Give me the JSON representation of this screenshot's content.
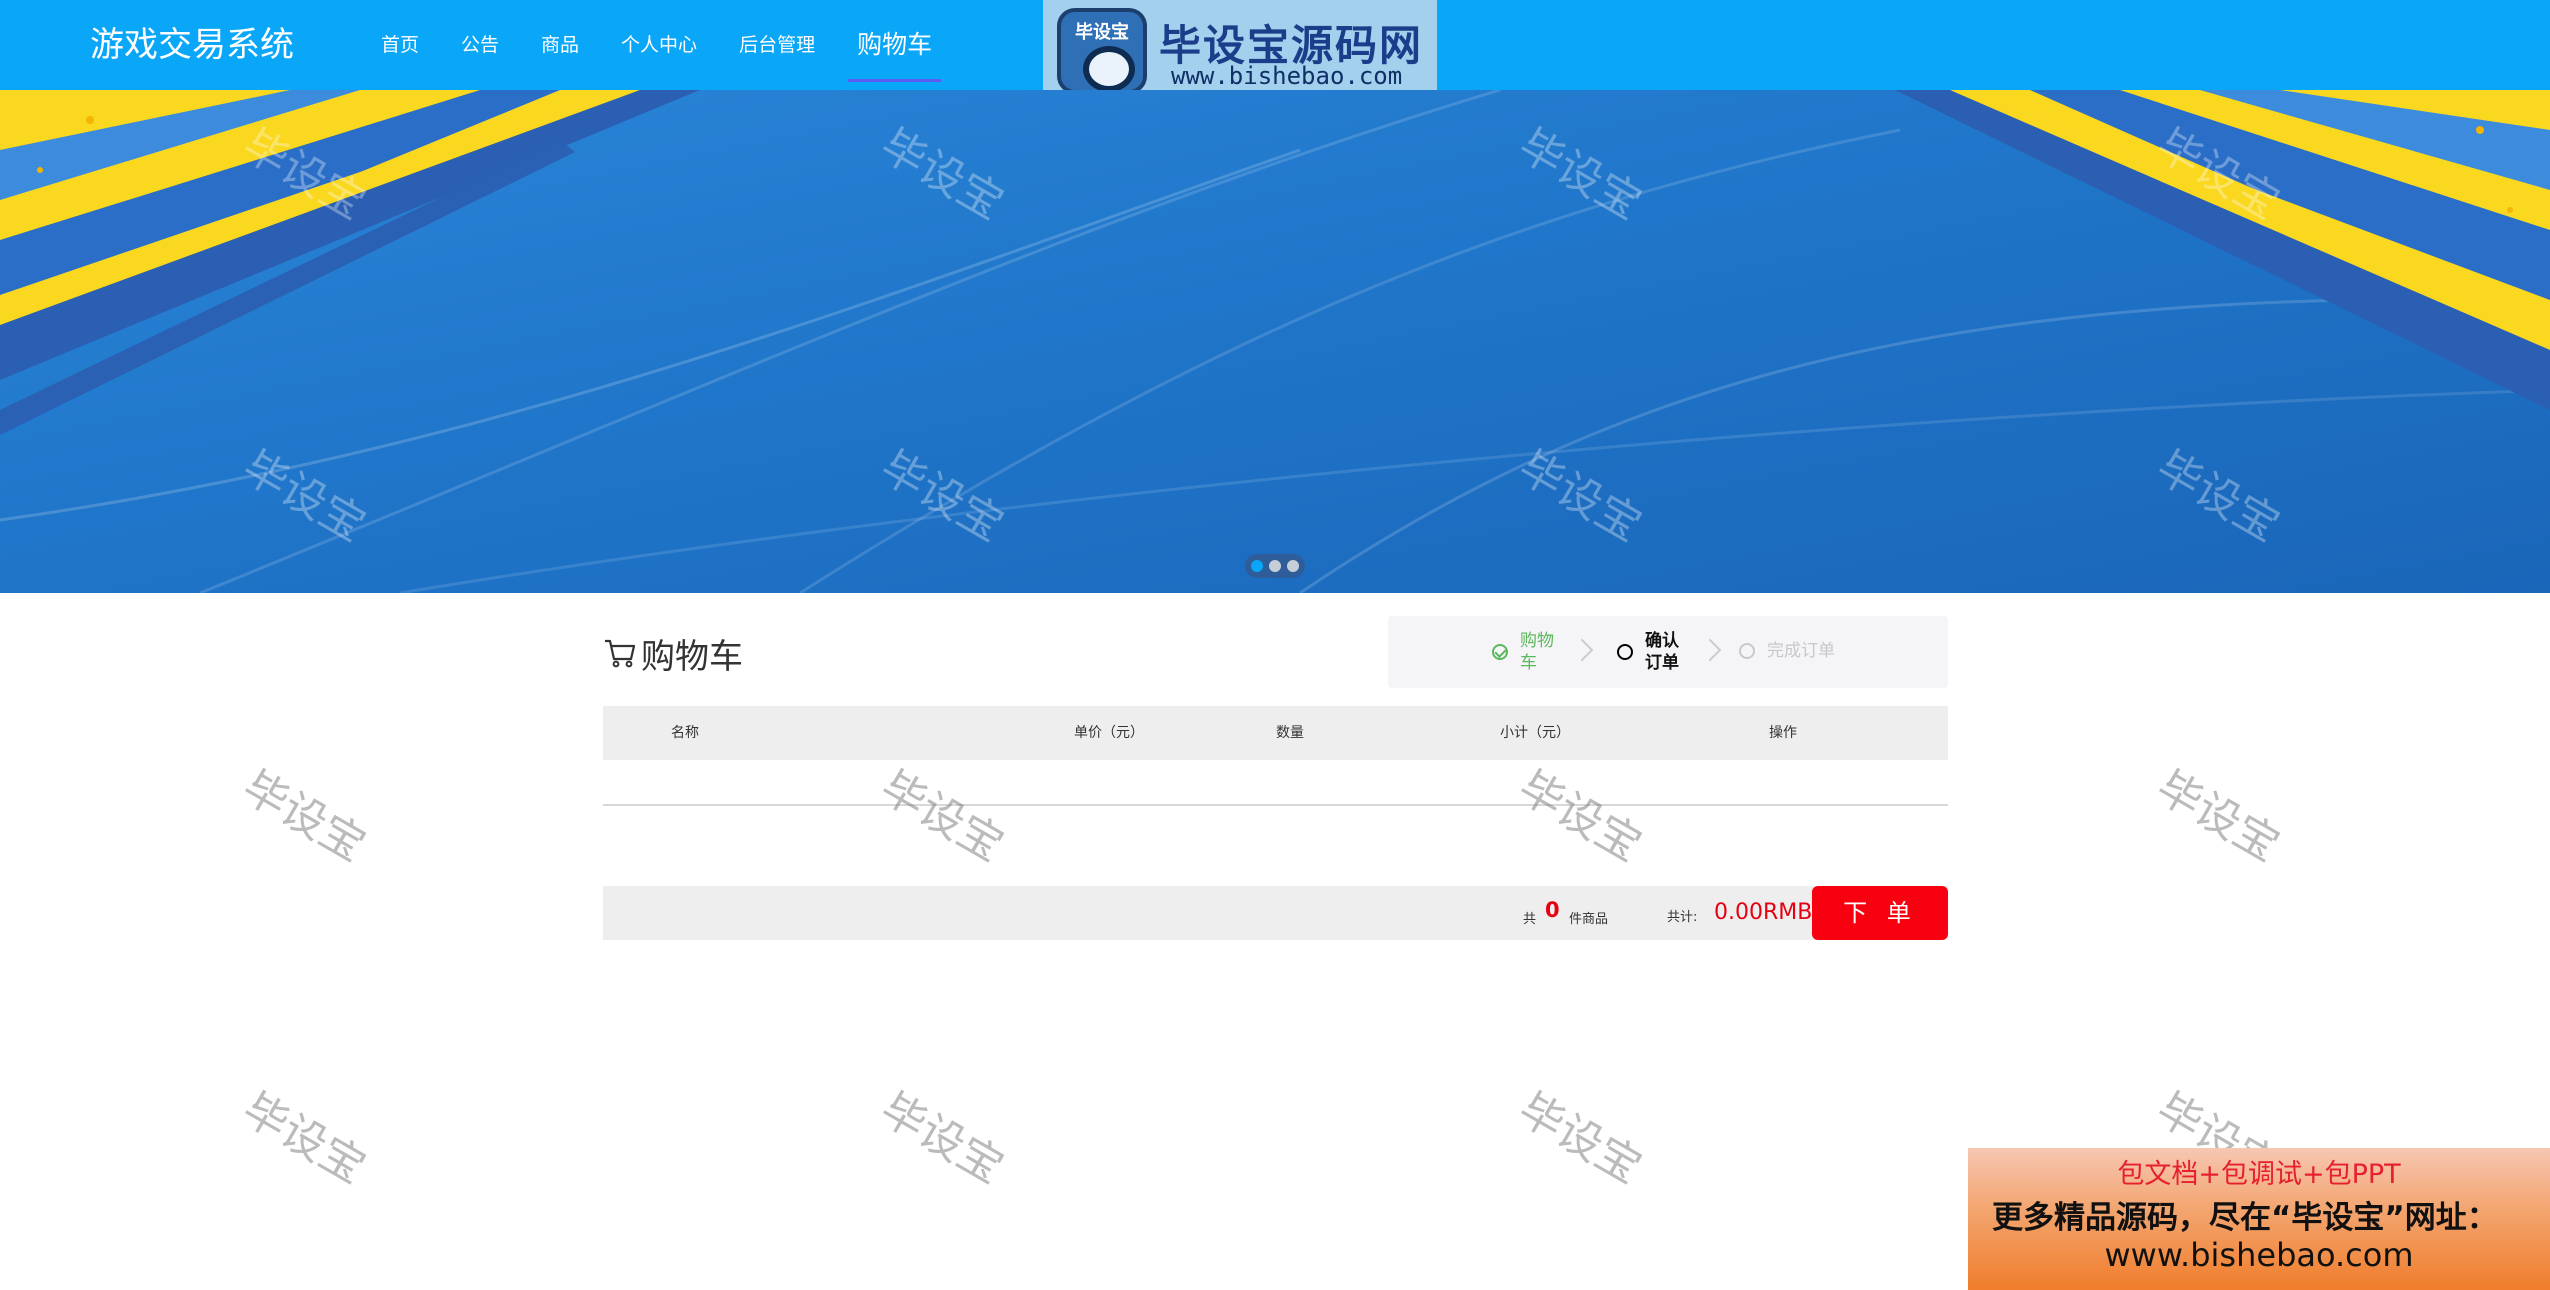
{
  "header": {
    "brand": "游戏交易系统",
    "nav": [
      {
        "label": "首页"
      },
      {
        "label": "公告"
      },
      {
        "label": "商品"
      },
      {
        "label": "个人中心"
      },
      {
        "label": "后台管理"
      },
      {
        "label": "购物车",
        "active": true
      }
    ]
  },
  "logo": {
    "badge_text": "毕设宝",
    "title": "毕设宝源码网",
    "url": "www.bishebao.com"
  },
  "carousel": {
    "slide_count": 3,
    "active_index": 0
  },
  "cart": {
    "title": "购物车",
    "steps": [
      {
        "label": "购物车",
        "state": "done"
      },
      {
        "label": "确认订单",
        "state": "current"
      },
      {
        "label": "完成订单",
        "state": "pending"
      }
    ],
    "columns": [
      "名称",
      "单价（元）",
      "数量",
      "小计（元）",
      "操作"
    ],
    "rows": [],
    "summary": {
      "prefix": "共",
      "count": "0",
      "suffix": "件商品",
      "total_label": "共计:",
      "total": "0.00RMB",
      "order_button": "下 单"
    }
  },
  "watermark": "毕设宝",
  "ad": {
    "line1": "包文档+包调试+包PPT",
    "line2": "更多精品源码，尽在“毕设宝”网址：",
    "line3": "www.bishebao.com"
  },
  "colors": {
    "header_bg": "#0aa6f8",
    "banner_blue": "#1e74c9",
    "banner_yellow": "#f9d81f",
    "order_button": "#f70010",
    "price_red": "#e60012",
    "step_done": "#5cb85c"
  }
}
